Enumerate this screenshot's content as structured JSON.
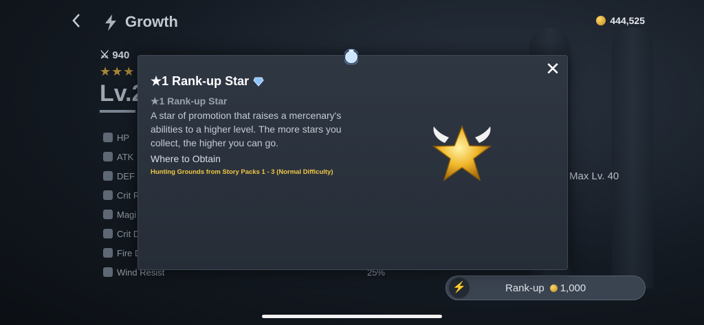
{
  "header": {
    "title": "Growth",
    "currency_value": "444,525"
  },
  "character": {
    "power": "940",
    "stars": "★★★",
    "level": "Lv.2"
  },
  "stats": [
    {
      "label": "HP",
      "value": ""
    },
    {
      "label": "ATK",
      "value": ""
    },
    {
      "label": "DEF",
      "value": ""
    },
    {
      "label": "Crit R",
      "value": ""
    },
    {
      "label": "Magi",
      "value": ""
    },
    {
      "label": "Crit D",
      "value": ""
    },
    {
      "label": "Fire D",
      "value": ""
    },
    {
      "label": "Wind Resist",
      "value": "25%"
    }
  ],
  "max_level": "Max Lv. 40",
  "rankup": {
    "label": "Rank-up",
    "cost": "1,000"
  },
  "modal": {
    "title": "★1 Rank-up Star",
    "subtitle": "★1 Rank-up Star",
    "description": "A star of promotion that raises a mercenary's abilities to a higher level. The more stars you collect, the higher you can go.",
    "obtain_heading": "Where to Obtain",
    "obtain_source": "Hunting Grounds from Story Packs 1 - 3 (Normal Difficulty)",
    "close_label": "✕"
  },
  "icons": {
    "back": "chevron-left-icon",
    "growth": "lightning-icon",
    "coin": "coin-icon",
    "diamond": "diamond-icon",
    "star": "winged-star-icon",
    "bag": "item-bag-icon"
  },
  "colors": {
    "accent_gold": "#f2c744",
    "modal_bg": "#2b323d"
  }
}
